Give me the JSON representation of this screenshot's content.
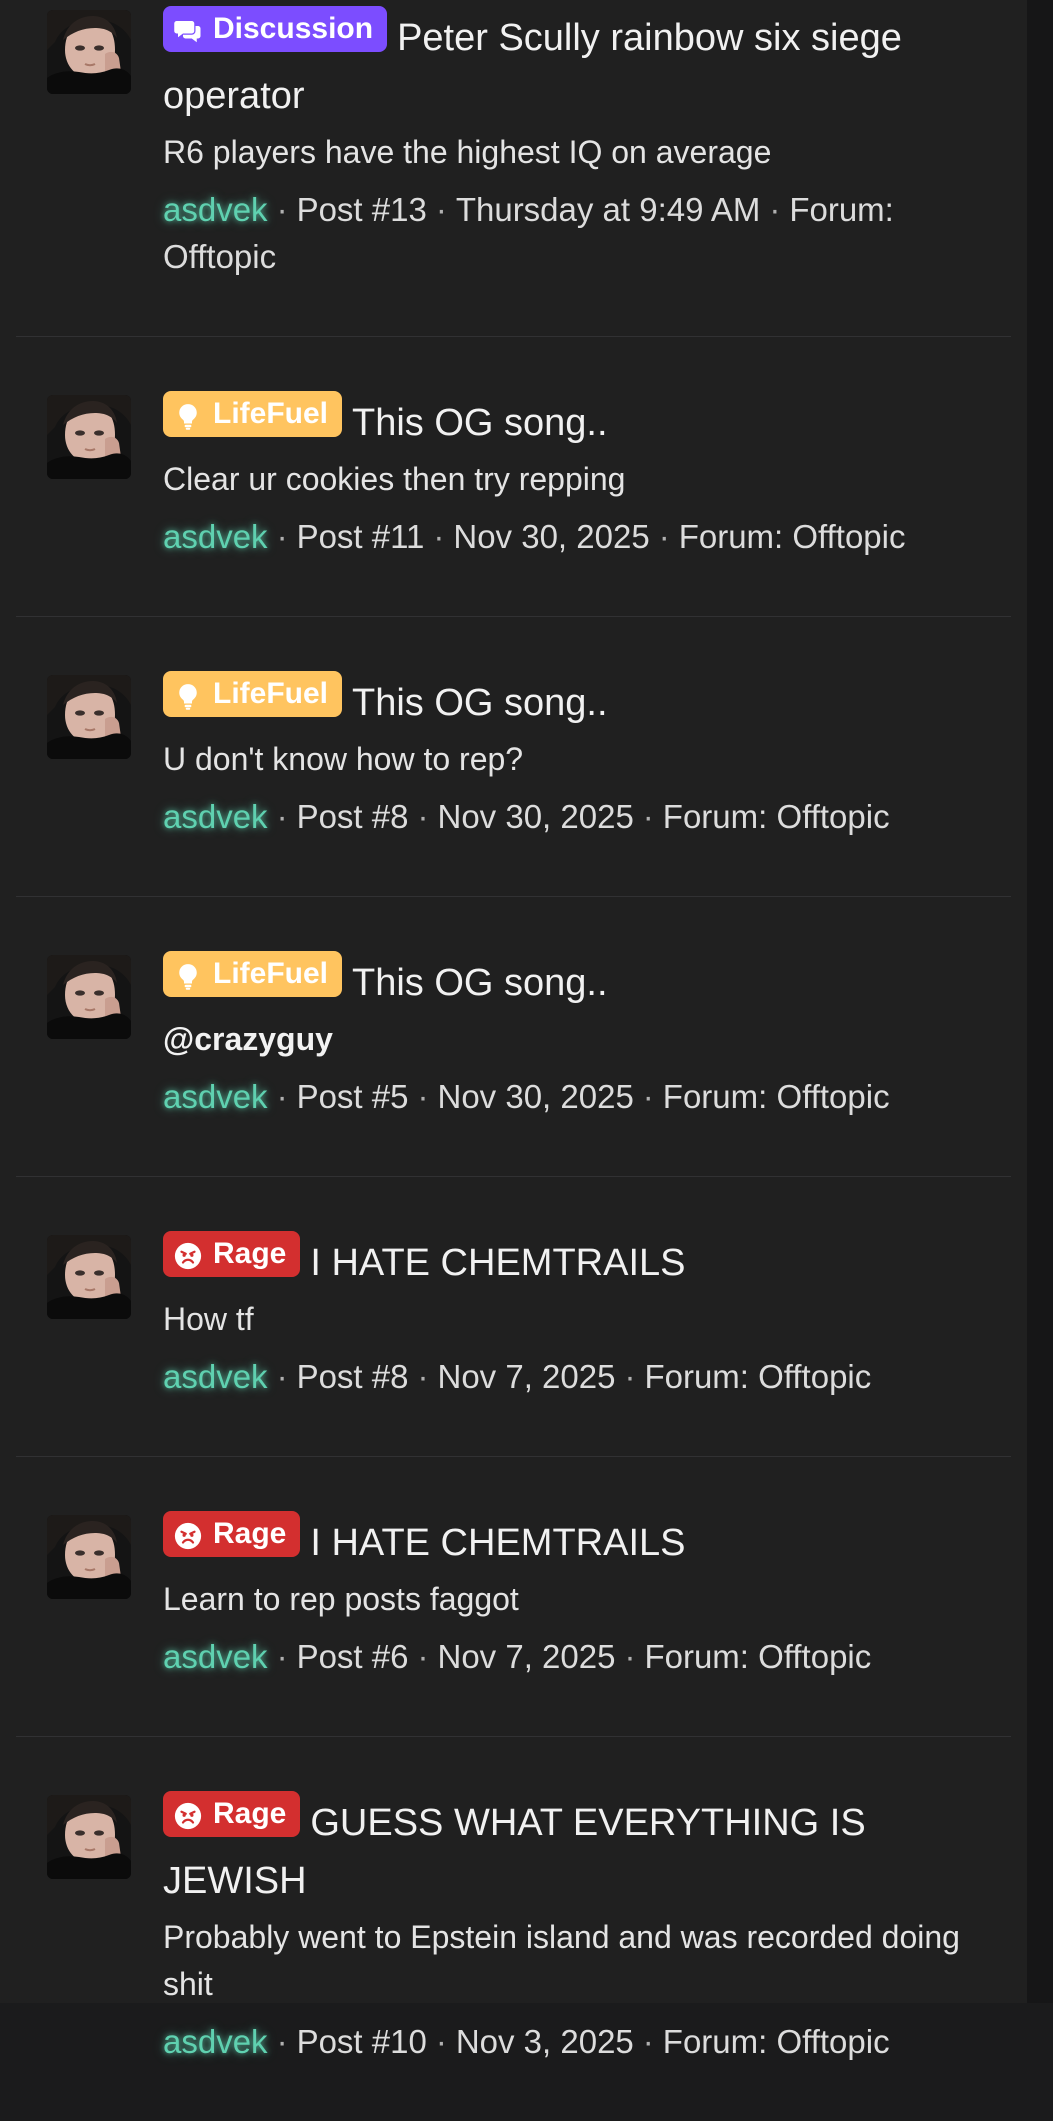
{
  "colors": {
    "background": "#202020",
    "username": "#5fd1b0",
    "prefix_lifefuel": "#ffc45f",
    "prefix_rage": "#d32f2f",
    "prefix_discussion": "#7c4dff",
    "divider": "#313133"
  },
  "results": [
    {
      "prefix": "Discussion",
      "prefix_icon": "speech-bubbles-icon",
      "title": "Peter Scully rainbow six siege operator",
      "snippet": "R6 players have the highest IQ on average",
      "user": "asdvek",
      "post": "Post #13",
      "date": "Thursday at 9:49 AM",
      "forum": "Forum: Offtopic"
    },
    {
      "prefix": "LifeFuel",
      "prefix_icon": "lightbulb-icon",
      "title": "This OG song..",
      "snippet": "Clear ur cookies then try repping",
      "user": "asdvek",
      "post": "Post #11",
      "date": "Nov 30, 2025",
      "forum": "Forum: Offtopic"
    },
    {
      "prefix": "LifeFuel",
      "prefix_icon": "lightbulb-icon",
      "title": "This OG song..",
      "snippet": "U don't know how to rep?",
      "user": "asdvek",
      "post": "Post #8",
      "date": "Nov 30, 2025",
      "forum": "Forum: Offtopic"
    },
    {
      "prefix": "LifeFuel",
      "prefix_icon": "lightbulb-icon",
      "title": "This OG song..",
      "snippet": "@crazyguy",
      "user": "asdvek",
      "post": "Post #5",
      "date": "Nov 30, 2025",
      "forum": "Forum: Offtopic"
    },
    {
      "prefix": "Rage",
      "prefix_icon": "angry-face-icon",
      "title": "I HATE CHEMTRAILS",
      "snippet": "How tf",
      "user": "asdvek",
      "post": "Post #8",
      "date": "Nov 7, 2025",
      "forum": "Forum: Offtopic"
    },
    {
      "prefix": "Rage",
      "prefix_icon": "angry-face-icon",
      "title": "I HATE CHEMTRAILS",
      "snippet": "Learn to rep posts faggot",
      "user": "asdvek",
      "post": "Post #6",
      "date": "Nov 7, 2025",
      "forum": "Forum: Offtopic"
    },
    {
      "prefix": "Rage",
      "prefix_icon": "angry-face-icon",
      "title": "GUESS WHAT EVERYTHING IS JEWISH",
      "snippet": "Probably went to Epstein island and was recorded doing shit",
      "user": "asdvek",
      "post": "Post #10",
      "date": "Nov 3, 2025",
      "forum": "Forum: Offtopic"
    }
  ]
}
